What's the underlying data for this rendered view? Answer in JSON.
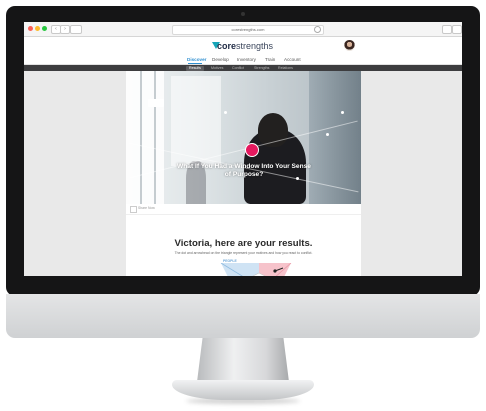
{
  "browser": {
    "url": "corestrengths.com",
    "back_symbol": "‹",
    "forward_symbol": "›",
    "window_controls": [
      {
        "name": "close",
        "color": "#fc5f57"
      },
      {
        "name": "minimize",
        "color": "#fdbc2e"
      },
      {
        "name": "zoom",
        "color": "#28c840"
      }
    ]
  },
  "site": {
    "logo_bold": "core",
    "logo_light": "strengths",
    "brand_color": "#17a5b8",
    "main_nav": [
      "Discover",
      "Develop",
      "Inventory",
      "Train",
      "Account"
    ],
    "main_nav_active": "Discover",
    "sub_nav": [
      "Results",
      "Motives",
      "Conflict",
      "Strengths",
      "Relations"
    ],
    "sub_nav_active": "Results"
  },
  "hero": {
    "title": "What If You Had a Window Into Your Sense of Purpose?",
    "accent_color": "#e5195f"
  },
  "share": {
    "label": "Share Now"
  },
  "results": {
    "title": "Victoria, here are your results.",
    "subtitle": "The dot and arrowhead on the triangle represent your motives and how you react to conflict.",
    "people_label": "PEOPLE",
    "people_color": "#6fa8d8",
    "conflict_color": "#e56a7a"
  },
  "icons": [
    "close-dot",
    "minimize-dot",
    "zoom-dot",
    "back-icon",
    "forward-icon",
    "sidebar-icon",
    "share-icon",
    "tabs-icon",
    "reload-icon",
    "avatar",
    "logo-mark-icon"
  ]
}
